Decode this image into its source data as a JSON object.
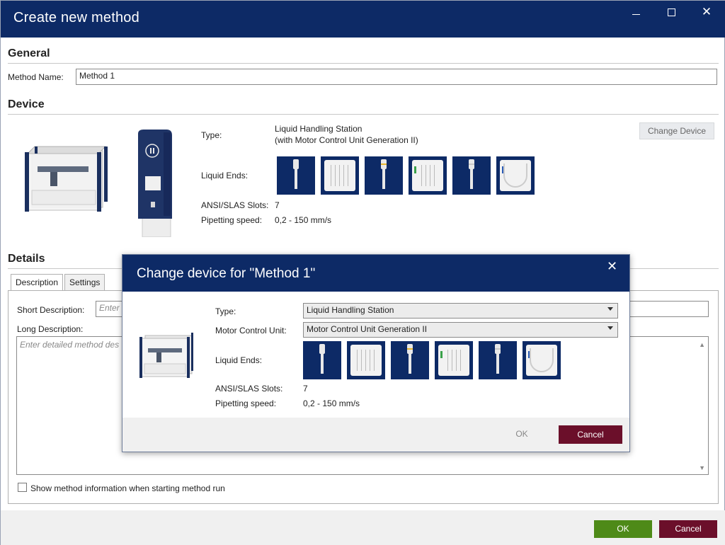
{
  "window": {
    "title": "Create new method",
    "controls": {
      "minimize": "minimize-icon",
      "maximize": "maximize-icon",
      "close": "close-icon"
    }
  },
  "general": {
    "heading": "General",
    "method_name_label": "Method Name:",
    "method_name_value": "Method 1"
  },
  "device": {
    "heading": "Device",
    "type_label": "Type:",
    "type_value_line1": "Liquid Handling Station",
    "type_value_line2": "(with Motor Control Unit Generation II)",
    "liquid_ends_label": "Liquid Ends:",
    "slots_label": "ANSI/SLAS Slots:",
    "slots_value": "7",
    "speed_label": "Pipetting speed:",
    "speed_value": "0,2 - 150 mm/s",
    "change_device_button": "Change Device",
    "liquid_ends": [
      "single-channel-pipette-icon",
      "multichannel-pipette-icon",
      "single-channel-pipette-yellow-icon",
      "multichannel-pipette-green-icon",
      "single-channel-pipette-icon",
      "single-channel-reservoir-icon"
    ]
  },
  "details": {
    "heading": "Details",
    "tabs": [
      "Description",
      "Settings"
    ],
    "short_description_label": "Short Description:",
    "short_description_placeholder": "Enter",
    "long_description_label": "Long Description:",
    "long_description_placeholder": "Enter detailed method des",
    "show_info_checkbox_label": "Show method information when starting method run"
  },
  "footer": {
    "ok": "OK",
    "cancel": "Cancel"
  },
  "modal": {
    "title": "Change device for \"Method 1\"",
    "type_label": "Type:",
    "type_value": "Liquid Handling Station",
    "mcu_label": "Motor Control Unit:",
    "mcu_value": "Motor Control Unit Generation II",
    "liquid_ends_label": "Liquid Ends:",
    "slots_label": "ANSI/SLAS Slots:",
    "slots_value": "7",
    "speed_label": "Pipetting speed:",
    "speed_value": "0,2 - 150 mm/s",
    "ok": "OK",
    "cancel": "Cancel"
  },
  "colors": {
    "navy": "#0d2a66",
    "ok_green": "#4e8a18",
    "cancel_maroon": "#6b0f2a"
  }
}
